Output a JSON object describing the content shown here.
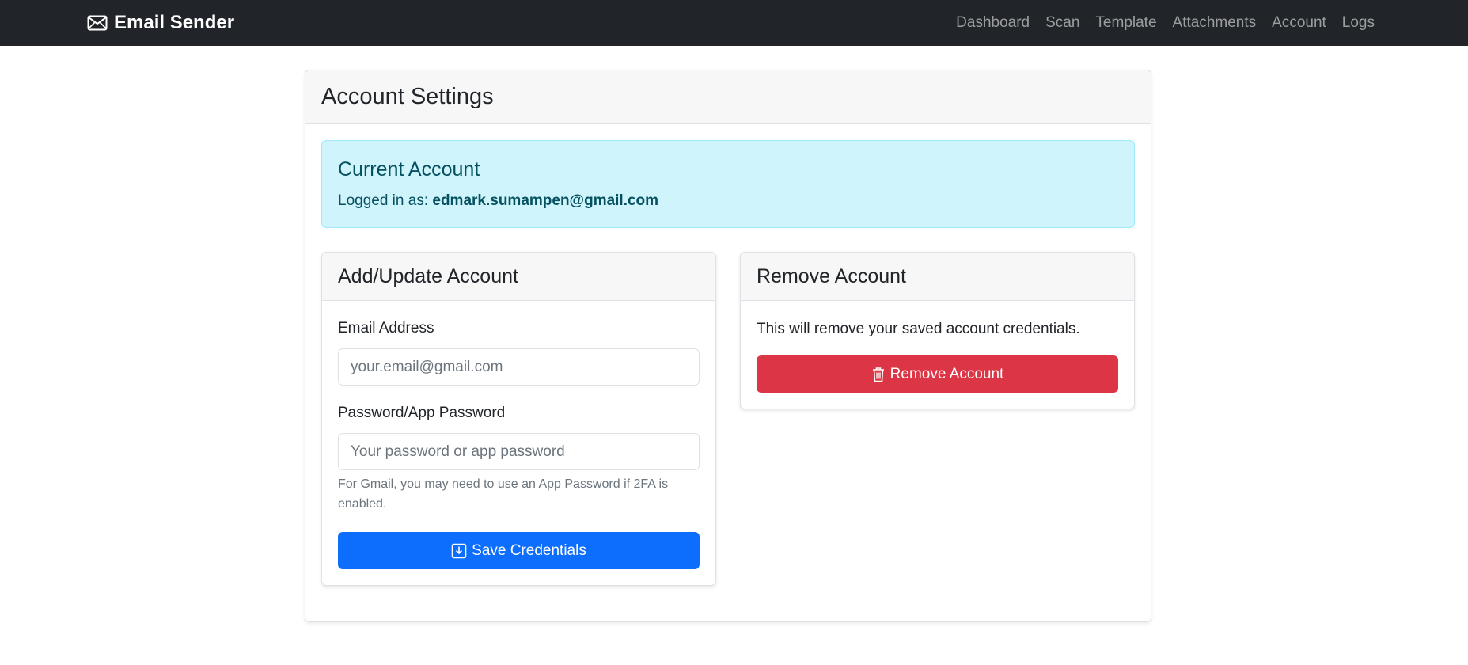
{
  "navbar": {
    "brand": "Email Sender",
    "brand_icon": "envelope-icon",
    "links": [
      "Dashboard",
      "Scan",
      "Template",
      "Attachments",
      "Account",
      "Logs"
    ]
  },
  "page": {
    "title": "Account Settings"
  },
  "current_account": {
    "title": "Current Account",
    "label": "Logged in as:",
    "email": "edmark.sumampen@gmail.com"
  },
  "add_account": {
    "title": "Add/Update Account",
    "email_label": "Email Address",
    "email_value": "",
    "email_placeholder": "your.email@gmail.com",
    "password_label": "Password/App Password",
    "password_value": "",
    "password_placeholder": "Your password or app password",
    "hint": "For Gmail, you may need to use an App Password if 2FA is enabled.",
    "save_label": "Save Credentials",
    "save_icon": "download-icon"
  },
  "remove_account": {
    "title": "Remove Account",
    "description": "This will remove your saved account credentials.",
    "remove_label": "Remove Account",
    "remove_icon": "trash-icon"
  },
  "colors": {
    "navbar_bg": "#212529",
    "primary": "#0d6efd",
    "danger": "#dc3545",
    "info_bg": "#cff4fc",
    "info_text": "#055160"
  }
}
